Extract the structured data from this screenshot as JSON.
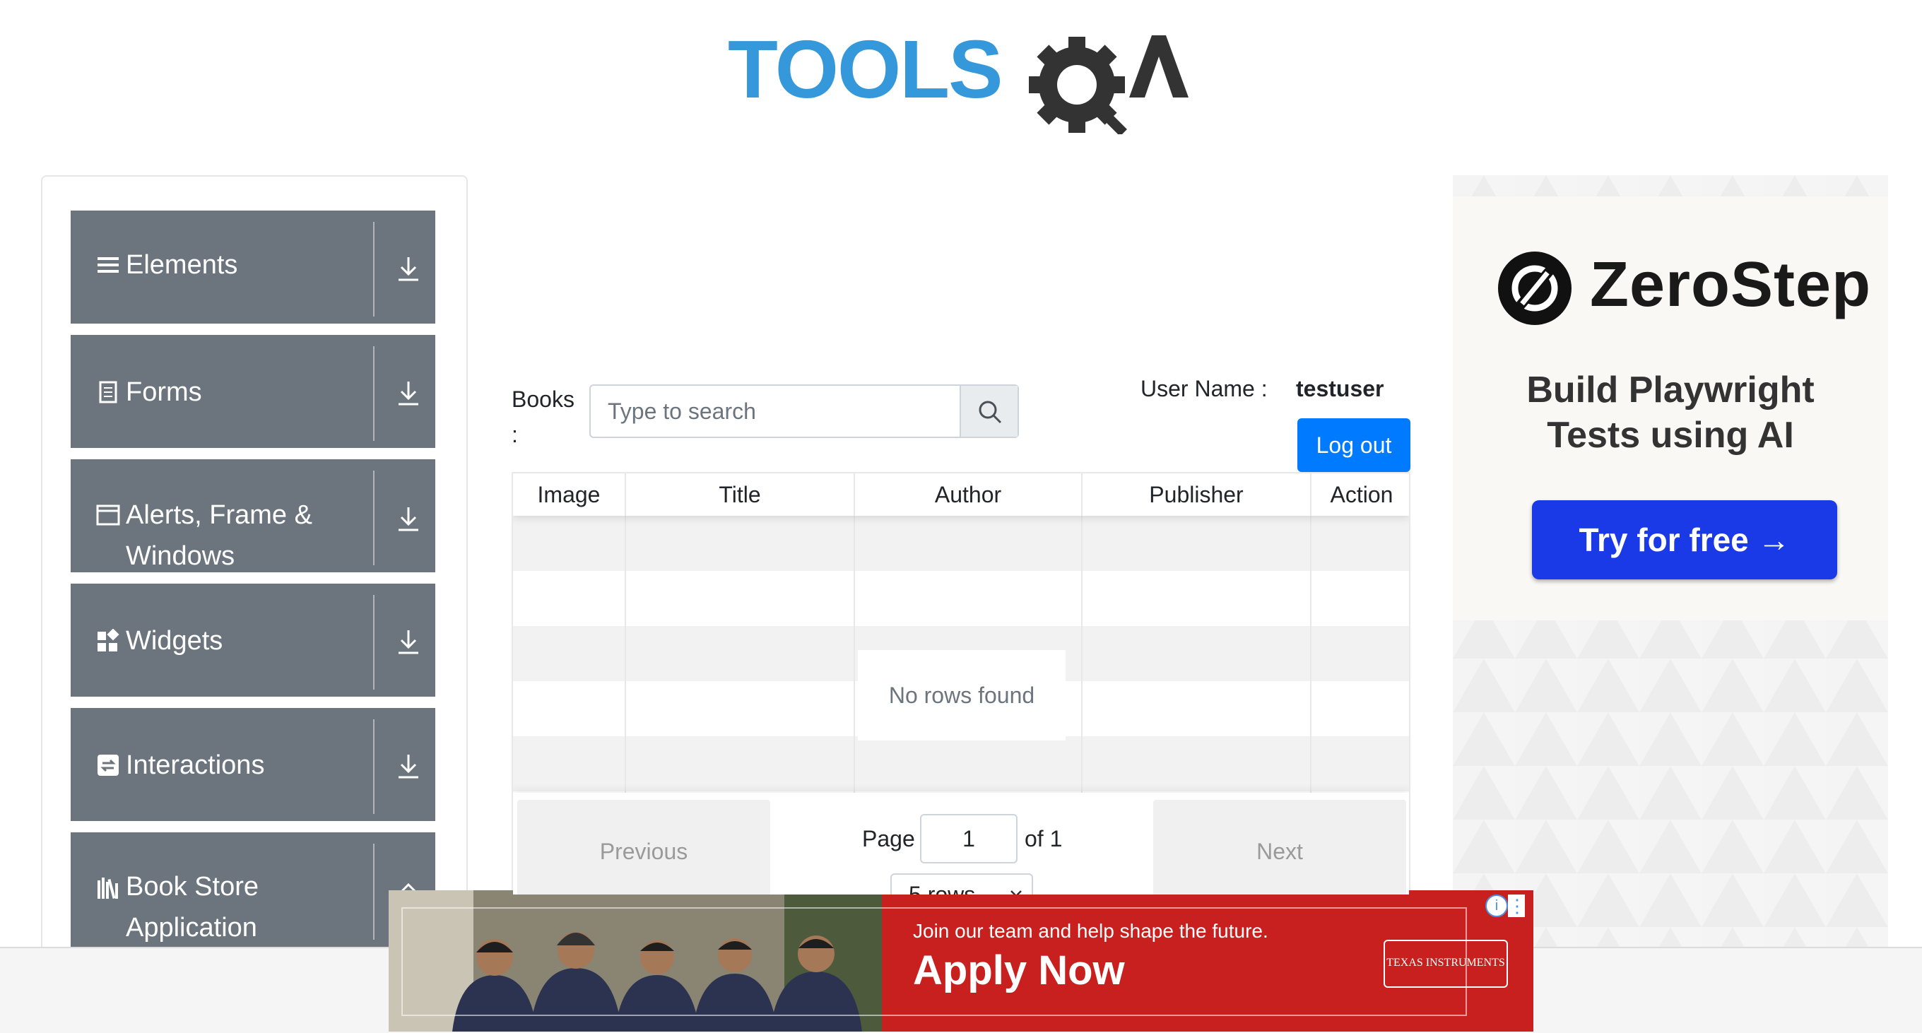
{
  "header": {
    "logo_text": "TOOLSQA",
    "logo_color": "#3498db"
  },
  "sidebar": {
    "groups": [
      {
        "label": "Elements",
        "icon": "hamburger-icon"
      },
      {
        "label": "Forms",
        "icon": "document-icon"
      },
      {
        "label": "Alerts, Frame &",
        "label2": "Windows",
        "icon": "window-icon"
      },
      {
        "label": "Widgets",
        "icon": "widgets-icon"
      },
      {
        "label": "Interactions",
        "icon": "interaction-icon"
      },
      {
        "label": "Book Store",
        "label2": "Application",
        "icon": "books-icon"
      }
    ]
  },
  "main": {
    "books_label": "Books",
    "books_colon": ":",
    "search": {
      "placeholder": "Type to search"
    },
    "user_label": "User Name :",
    "user_value": "testuser",
    "logout_label": "Log out",
    "table": {
      "columns": [
        "Image",
        "Title",
        "Author",
        "Publisher",
        "Action"
      ],
      "empty_text": "No rows found"
    },
    "pagination": {
      "previous": "Previous",
      "next": "Next",
      "page_label": "Page",
      "page_value": "1",
      "of_label": "of 1",
      "rows_selected": "5 rows"
    }
  },
  "right_ad": {
    "brand": "ZeroStep",
    "line1": "Build Playwright",
    "line2": "Tests using AI",
    "cta": "Try for free →",
    "cta_color": "#1a3ae8"
  },
  "bottom_ad": {
    "small_text": "Join our team and help shape the future.",
    "big_text": "Apply Now",
    "logo_text": "TEXAS INSTRUMENTS",
    "bg_color": "#c8201f"
  }
}
